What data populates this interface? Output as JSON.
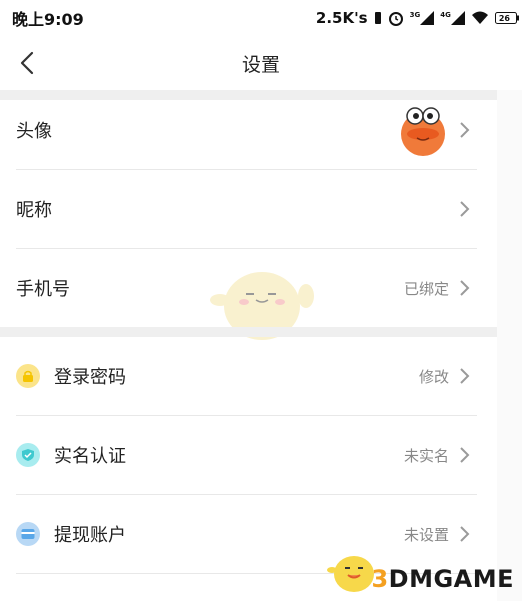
{
  "status_bar": {
    "time": "晚上9:09",
    "speed": "2.5K's",
    "signal_3g": "3G",
    "signal_4g": "4G",
    "battery": "26"
  },
  "header": {
    "title": "设置"
  },
  "profile_rows": [
    {
      "label": "头像",
      "value": ""
    },
    {
      "label": "昵称",
      "value": ""
    },
    {
      "label": "手机号",
      "value": "已绑定"
    }
  ],
  "account_rows": [
    {
      "label": "登录密码",
      "value": "修改",
      "icon": "lock-icon",
      "color": "#f7d24a"
    },
    {
      "label": "实名认证",
      "value": "未实名",
      "icon": "shield-icon",
      "color": "#3fc9cf"
    },
    {
      "label": "提现账户",
      "value": "未设置",
      "icon": "card-icon",
      "color": "#5aa7e8"
    }
  ],
  "watermark": {
    "prefix": "3",
    "text": "DMGAME"
  },
  "colors": {
    "chevron": "#9a9a9a",
    "divider": "#efefef",
    "value_text": "#888888"
  }
}
